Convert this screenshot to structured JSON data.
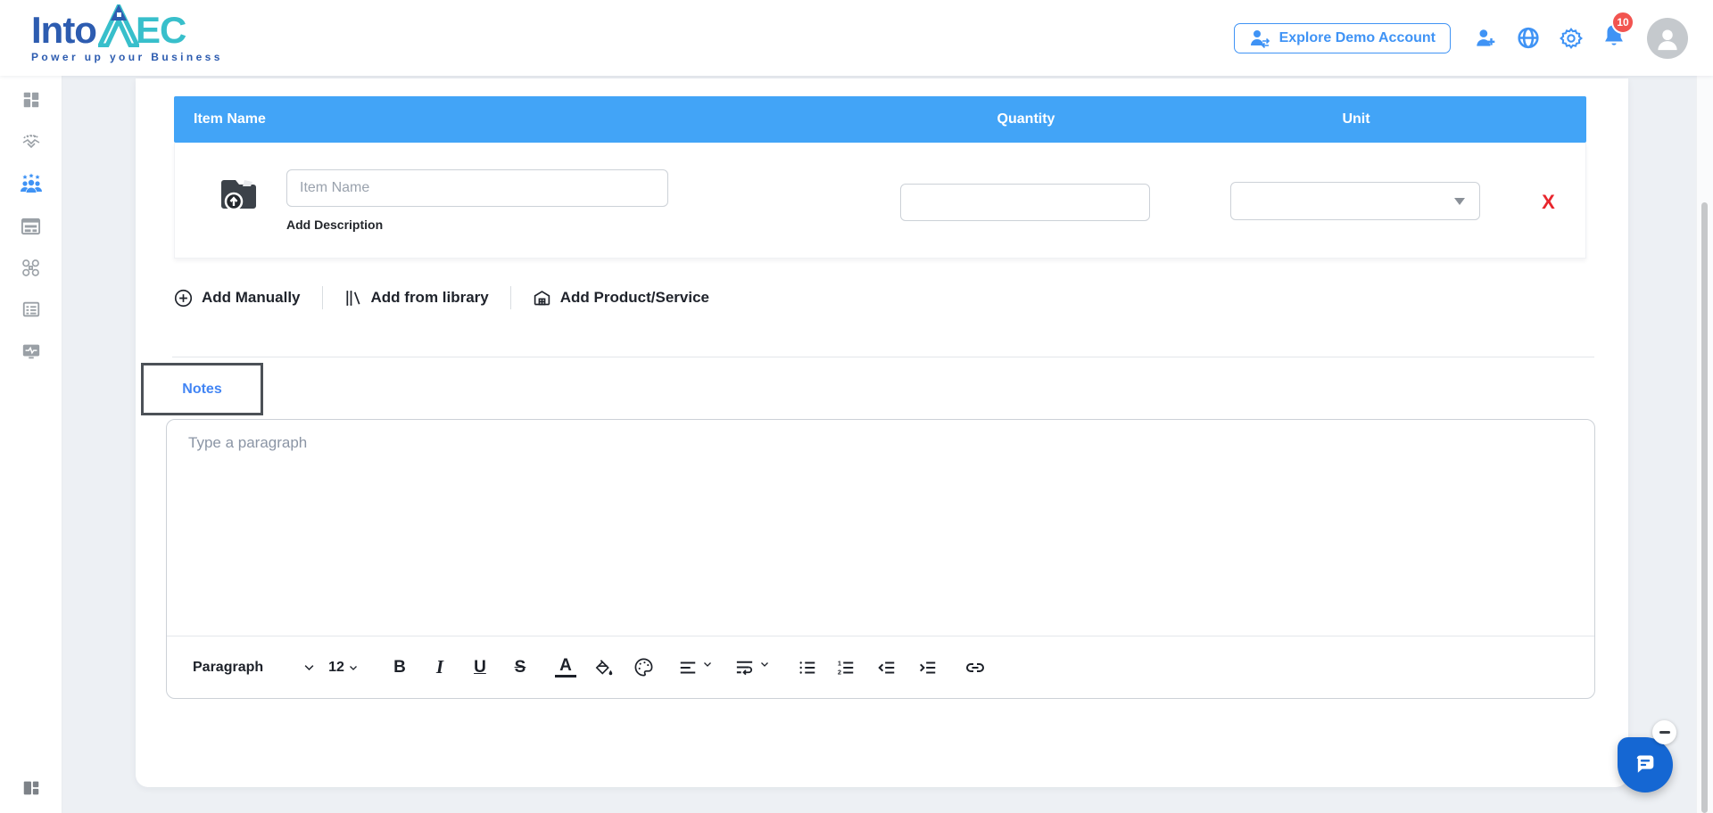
{
  "header": {
    "logo": {
      "part1": "Into",
      "part2": "EC",
      "tagline": "Power up your Business"
    },
    "explore_demo_button": "Explore Demo Account",
    "notification_badge": "10",
    "icons": [
      "person-add-icon",
      "globe-icon",
      "gear-icon",
      "bell-icon",
      "avatar"
    ]
  },
  "sidebar": {
    "items": [
      {
        "icon": "dashboard-icon",
        "active": false
      },
      {
        "icon": "partnership-icon",
        "active": false
      },
      {
        "icon": "team-icon",
        "active": true
      },
      {
        "icon": "form-window-icon",
        "active": false
      },
      {
        "icon": "integrations-icon",
        "active": false
      },
      {
        "icon": "documents-icon",
        "active": false
      },
      {
        "icon": "activity-monitor-icon",
        "active": false
      }
    ],
    "bottom_icon": "collapse-sidebar-icon"
  },
  "items_table": {
    "columns": [
      "Item Name",
      "Quantity",
      "Unit"
    ],
    "row": {
      "item_name_placeholder": "Item Name",
      "add_description_label": "Add Description",
      "quantity_value": "",
      "unit_value": "",
      "upload_icon": "upload-folder-icon",
      "delete_label": "X"
    }
  },
  "actions": {
    "add_manually": "Add Manually",
    "add_from_library": "Add from library",
    "add_product_service": "Add Product/Service"
  },
  "notes": {
    "tab_label": "Notes",
    "editor_placeholder": "Type a paragraph",
    "toolbar": {
      "paragraph_label": "Paragraph",
      "font_size": "12",
      "bold_label": "B",
      "italic_label": "I",
      "underline_label": "U",
      "strikethrough_label": "S",
      "font_color_label": "A"
    }
  },
  "chat": {
    "icons": [
      "chat-bubble-icon",
      "minimize-icon"
    ]
  },
  "colors": {
    "table_header_blue": "#42a4f7",
    "accent_blue": "#3f93f5",
    "notes_tab_blue": "#4285f4",
    "logo_blue": "#2d5cb0",
    "logo_teal": "#38bfcb",
    "badge_red": "#f25450",
    "delete_red": "#e8262d",
    "chat_blue": "#1567d3",
    "page_background": "#edf0f4"
  }
}
